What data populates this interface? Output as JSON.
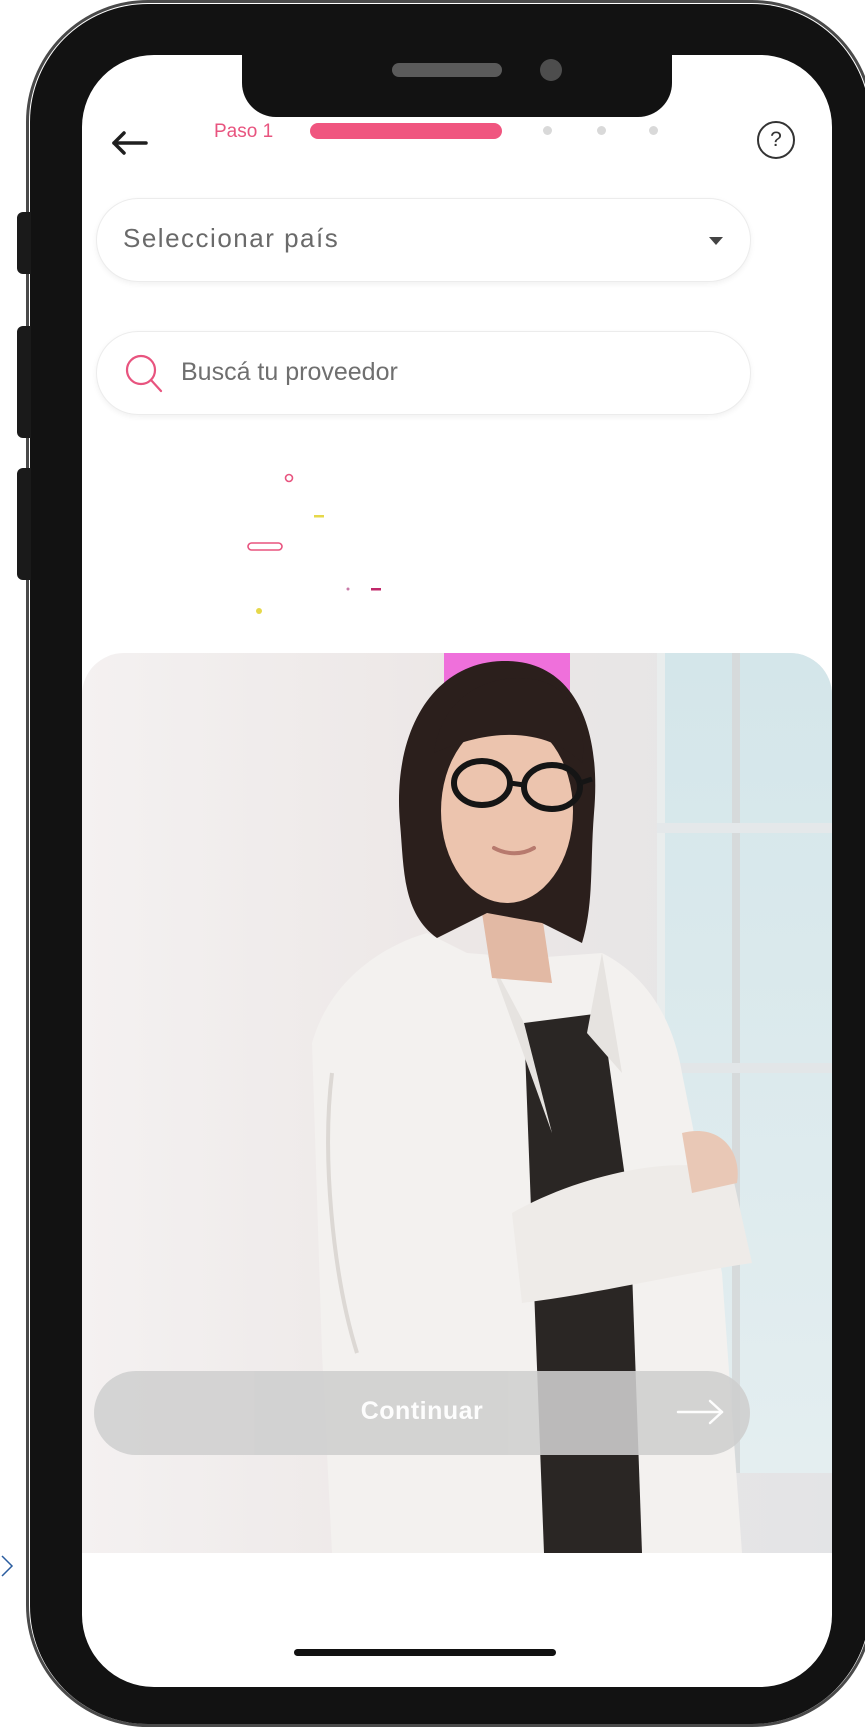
{
  "header": {
    "step_label": "Paso 1",
    "help_label": "?",
    "back_icon": "arrow-left-icon",
    "active_color": "#f0557f"
  },
  "country_select": {
    "value": "Seleccionar país",
    "icon": "caret-down-icon"
  },
  "search": {
    "placeholder": "Buscá tu proveedor",
    "icon": "search-icon",
    "icon_color": "#e8547f"
  },
  "hero": {
    "image": "professional-woman-photo"
  },
  "footer": {
    "continue_label": "Continuar",
    "continue_icon": "arrow-right-icon",
    "continue_color": "#cfcfcf"
  }
}
